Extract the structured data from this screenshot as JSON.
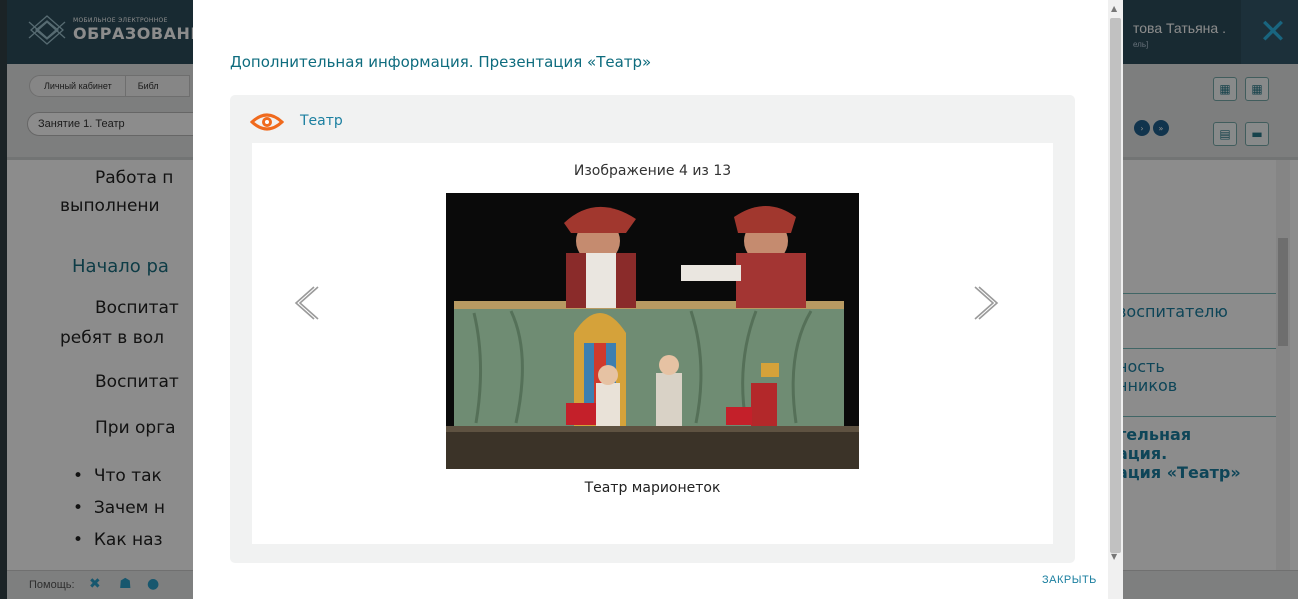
{
  "header": {
    "logo_small": "МОБИЛЬНОЕ ЭЛЕКТРОННОЕ",
    "logo_big": "ОБРАЗОВАНИЕ",
    "user_name": "това Татьяна .",
    "user_role": "ель]",
    "close_glyph": "✕"
  },
  "breadcrumb": [
    "Личный кабинет",
    "Библ"
  ],
  "lesson_select": {
    "value": "Занятие 1. Театр"
  },
  "background_content": {
    "lines": [
      "Работа п",
      "выполнени",
      "Начало ра",
      "Воспитат",
      "ребят в вол",
      "Воспитат",
      "При орга"
    ],
    "bullets": [
      "Что так",
      "Зачем н",
      "Как наз"
    ]
  },
  "right_nav": [
    "воспитателю",
    "ность\nнников",
    "тельная\nация.\nация «Театр»"
  ],
  "bottom_bar": {
    "help_label": "Помощь:"
  },
  "modal": {
    "title": "Дополнительная информация. Презентация «Театр»",
    "panel_title": "Театр",
    "counter": "Изображение 4 из 13",
    "caption": "Театр марионеток",
    "close_label": "ЗАКРЫТЬ",
    "prev_glyph": "‹",
    "next_glyph": "›"
  },
  "colors": {
    "accent": "#0e6c7e",
    "link": "#1b7fa0",
    "eye_icon": "#f06a1d",
    "header_bg": "#2c4d5b"
  },
  "icons": [
    "logo-mark",
    "close-icon",
    "eye-icon",
    "arrow-left-icon",
    "arrow-right-icon",
    "help-tools-icon",
    "help-user-icon",
    "help-info-icon"
  ]
}
